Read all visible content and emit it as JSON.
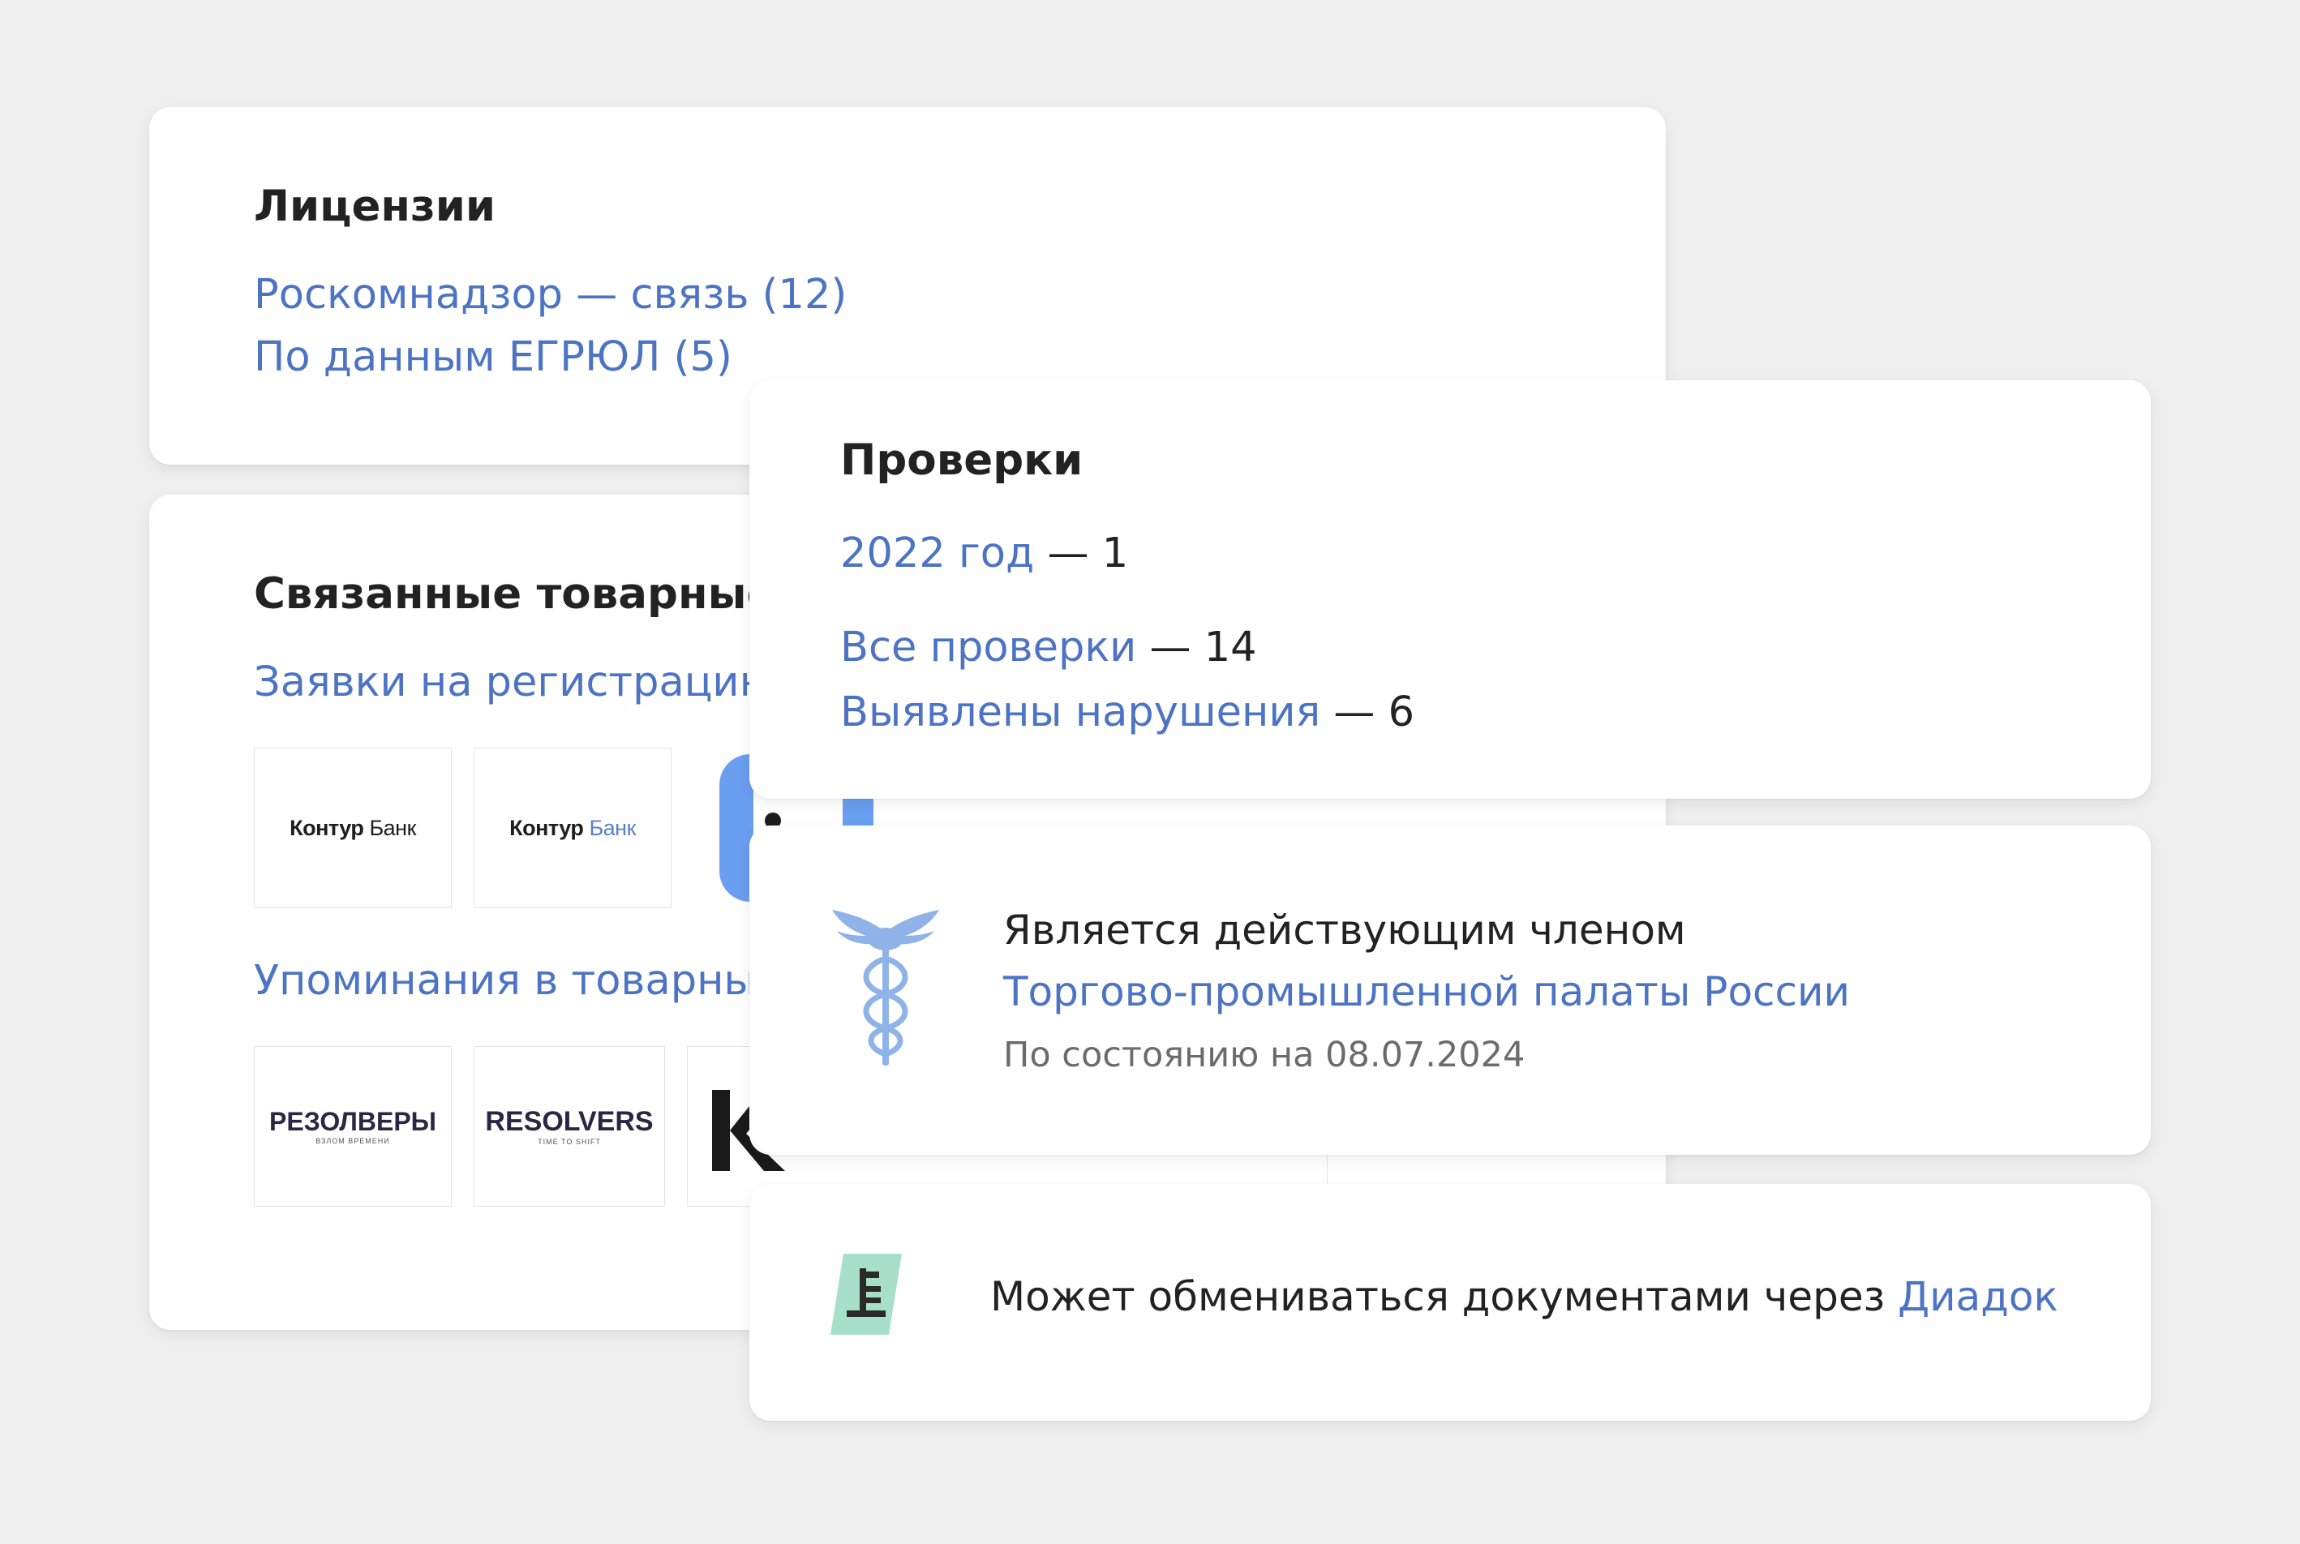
{
  "licenses": {
    "title": "Лицензии",
    "items": [
      {
        "label": "Роскомнадзор — связь (12)"
      },
      {
        "label": "По данным ЕГРЮЛ (5)"
      }
    ]
  },
  "trademarks": {
    "title": "Связанные товарные",
    "applications_label": "Заявки на регистрацию",
    "applications_suffix": " —",
    "mentions_label": "Упоминания в товарных зн",
    "application_logos": [
      {
        "main": "Контур",
        "sub": " Банк"
      },
      {
        "main": "Контур",
        "sub": " Банк"
      }
    ],
    "mention_logos": [
      {
        "main": "РЕЗОЛВЕРЫ",
        "sub": "ВЗЛОМ ВРЕМЕНИ"
      },
      {
        "main": "RESOLVERS",
        "sub": "TIME TO SHIFT"
      }
    ]
  },
  "checks": {
    "title": "Проверки",
    "year_link": "2022 год",
    "year_value": " — 1",
    "all_link": "Все проверки",
    "all_value": " — 14",
    "violations_link": "Выявлены нарушения",
    "violations_value": " — 6"
  },
  "chamber": {
    "icon": "caduceus-icon",
    "status_text": "Является действующим членом",
    "org_link": "Торгово-промышленной палаты России",
    "date_text": "По состоянию на 08.07.2024"
  },
  "diadoc": {
    "icon": "document-icon",
    "text": "Может обмениваться документами через ",
    "link": "Диадок"
  },
  "colors": {
    "link": "#4d74c4",
    "text": "#222222",
    "muted": "#6b6b6b",
    "icon_blue": "#8fb3e8",
    "icon_mint": "#a8dfcb",
    "background": "#efefef"
  }
}
